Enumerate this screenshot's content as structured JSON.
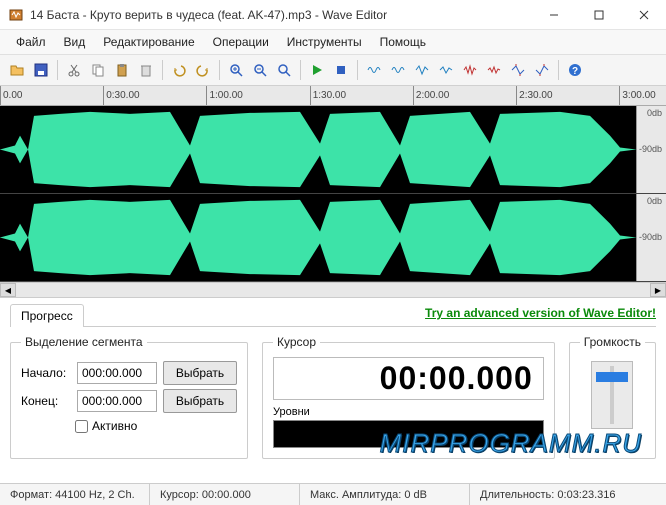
{
  "window": {
    "title": "14 Баста - Круто верить в чудеса (feat. AK-47).mp3 - Wave Editor"
  },
  "menu": {
    "file": "Файл",
    "view": "Вид",
    "edit": "Редактирование",
    "operations": "Операции",
    "tools": "Инструменты",
    "help": "Помощь"
  },
  "timeline": {
    "ticks": [
      "0.00",
      "0:30.00",
      "1:00.00",
      "1:30.00",
      "2:00.00",
      "2:30.00",
      "3:00.00"
    ]
  },
  "db": {
    "zero": "0db",
    "ninety": "-90db"
  },
  "tabs": {
    "progress": "Прогресс",
    "upgrade_link": "Try an advanced version of Wave Editor!"
  },
  "segment": {
    "legend": "Выделение сегмента",
    "start_label": "Начало:",
    "start_value": "000:00.000",
    "end_label": "Конец:",
    "end_value": "000:00.000",
    "select_btn": "Выбрать",
    "active_label": "Активно"
  },
  "cursor": {
    "legend": "Курсор",
    "time": "00:00.000",
    "levels_label": "Уровни"
  },
  "volume": {
    "legend": "Громкость"
  },
  "status": {
    "format": "Формат: 44100 Hz, 2 Ch.",
    "cursor": "Курсор: 00:00.000",
    "amplitude": "Макс. Амплитуда: 0 dB",
    "duration": "Длительность: 0:03:23.316"
  },
  "watermark": "MIRPROGRAMM.RU"
}
